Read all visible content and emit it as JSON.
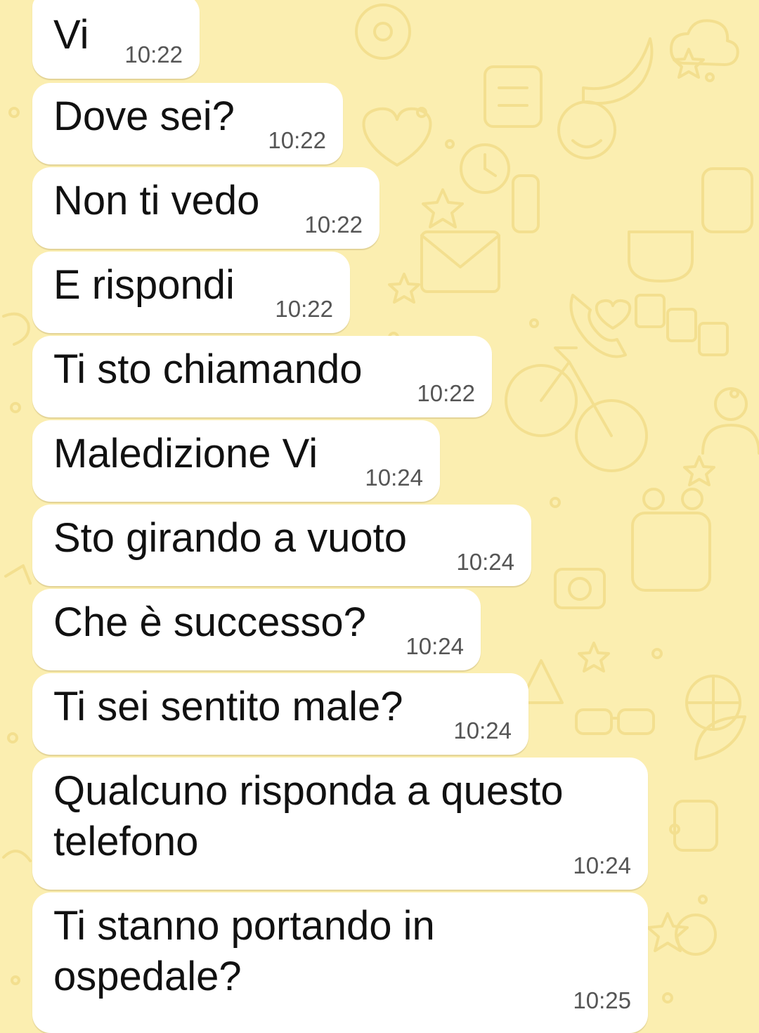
{
  "theme": {
    "background": "#fbeeb0",
    "bubble": "#ffffff",
    "doodle": "#f5e39a"
  },
  "messages": [
    {
      "text": "Vi",
      "time": "10:22"
    },
    {
      "text": "Dove sei?",
      "time": "10:22"
    },
    {
      "text": "Non ti vedo",
      "time": "10:22"
    },
    {
      "text": "E rispondi",
      "time": "10:22"
    },
    {
      "text": "Ti sto chiamando",
      "time": "10:22"
    },
    {
      "text": "Maledizione Vi",
      "time": "10:24"
    },
    {
      "text": "Sto girando a vuoto",
      "time": "10:24"
    },
    {
      "text": "Che è successo?",
      "time": "10:24"
    },
    {
      "text": "Ti sei sentito male?",
      "time": "10:24"
    },
    {
      "text": "Qualcuno risponda a questo telefono",
      "time": "10:24"
    },
    {
      "text": "Ti stanno portando in ospedale?",
      "time": "10:25"
    }
  ],
  "wallpaper": {
    "icons": [
      "donut-icon",
      "heart-icon",
      "star-icon",
      "calculator-icon",
      "clock-icon",
      "bicycle-icon",
      "camera-icon",
      "basketball-icon",
      "envelope-icon",
      "phone-icon",
      "banana-icon",
      "cloud-icon"
    ]
  }
}
